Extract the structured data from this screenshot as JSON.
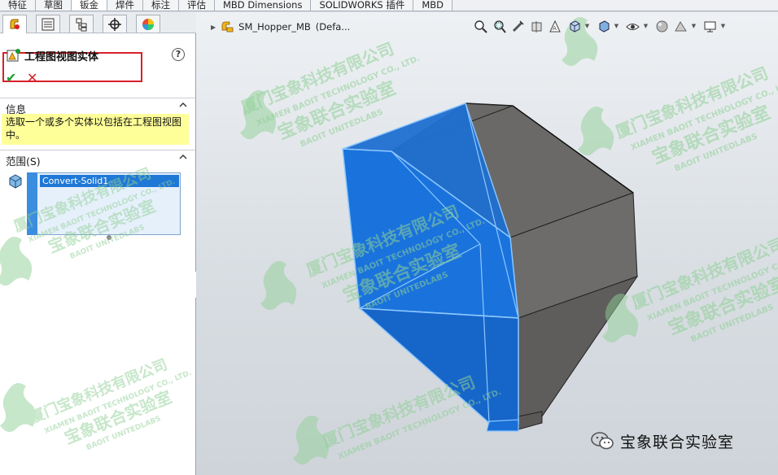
{
  "tabs": [
    {
      "label": "特征"
    },
    {
      "label": "草图"
    },
    {
      "label": "钣金",
      "active": true
    },
    {
      "label": "焊件"
    },
    {
      "label": "标注"
    },
    {
      "label": "评估"
    },
    {
      "label": "MBD Dimensions"
    },
    {
      "label": "SOLIDWORKS 插件"
    },
    {
      "label": "MBD"
    }
  ],
  "panel_tabs": [
    {
      "name": "property-manager-tab-icon"
    },
    {
      "name": "feature-tree-tab-icon"
    },
    {
      "name": "configuration-tab-icon"
    },
    {
      "name": "dimxpert-tab-icon"
    },
    {
      "name": "appearance-tab-icon"
    }
  ],
  "property_manager": {
    "title": "工程图视图实体",
    "help": "?",
    "ok": "✔",
    "cancel": "✕"
  },
  "info": {
    "header": "信息",
    "message": "选取一个或多个实体以包括在工程图视图中。"
  },
  "scope": {
    "header": "范围(S)",
    "items": [
      "Convert-Solid1"
    ]
  },
  "model_tree": {
    "part_name": "SM_Hopper_MB",
    "config": "(Defa..."
  },
  "watermark": {
    "cn": "厦门宝象科技有限公司",
    "en": "XIAMEN BAOIT TECHNOLOGY CO., LTD.",
    "cn2": "宝象联合实验室",
    "en2": "BAOIT UNITEDLABS"
  },
  "footer_badge": {
    "text": "宝象联合实验室"
  },
  "colors": {
    "selected_face": "#1f78d6",
    "model_gray": "#6b6a69",
    "highlight_box": "#d9202a",
    "info_bg": "#ffff99",
    "watermark_green": "#8fcf95"
  }
}
